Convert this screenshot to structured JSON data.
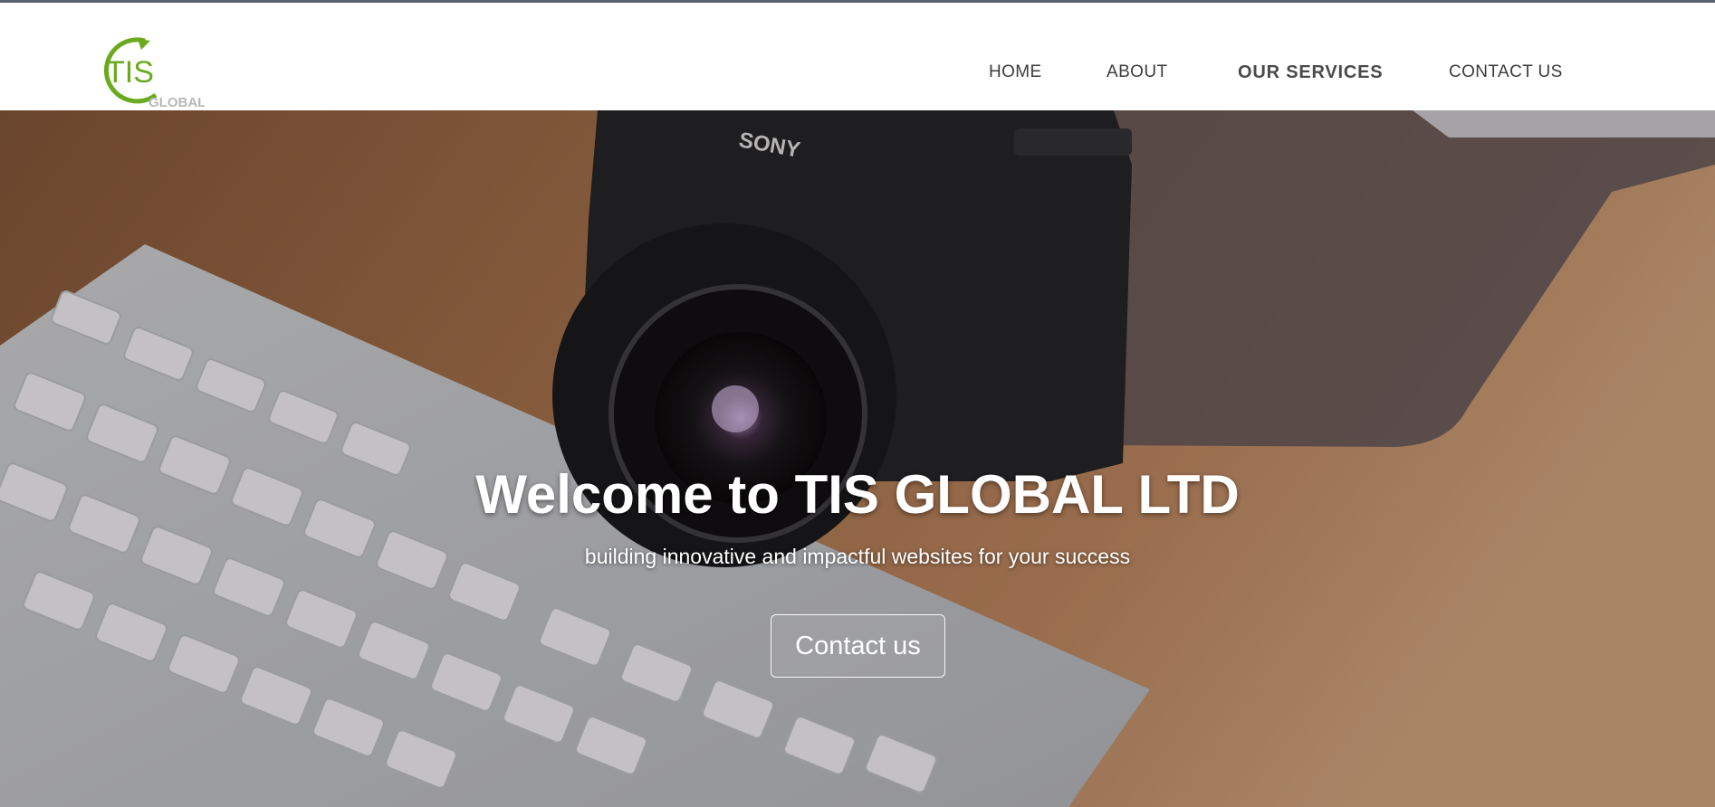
{
  "brand": {
    "logo_text": "TIS",
    "logo_subtext": "GLOBAL",
    "accent_color": "#6aaa1e"
  },
  "nav": {
    "items": [
      {
        "label": "HOME"
      },
      {
        "label": "ABOUT"
      },
      {
        "label": "OUR SERVICES",
        "active": true
      },
      {
        "label": "CONTACT US"
      }
    ]
  },
  "hero": {
    "title": "Welcome to TIS GLOBAL LTD",
    "subtitle": "building innovative and impactful websites for your success",
    "cta_label": "Contact us",
    "background_image": "camera-and-keyboard-on-desk",
    "camera_brand": "SONY"
  }
}
